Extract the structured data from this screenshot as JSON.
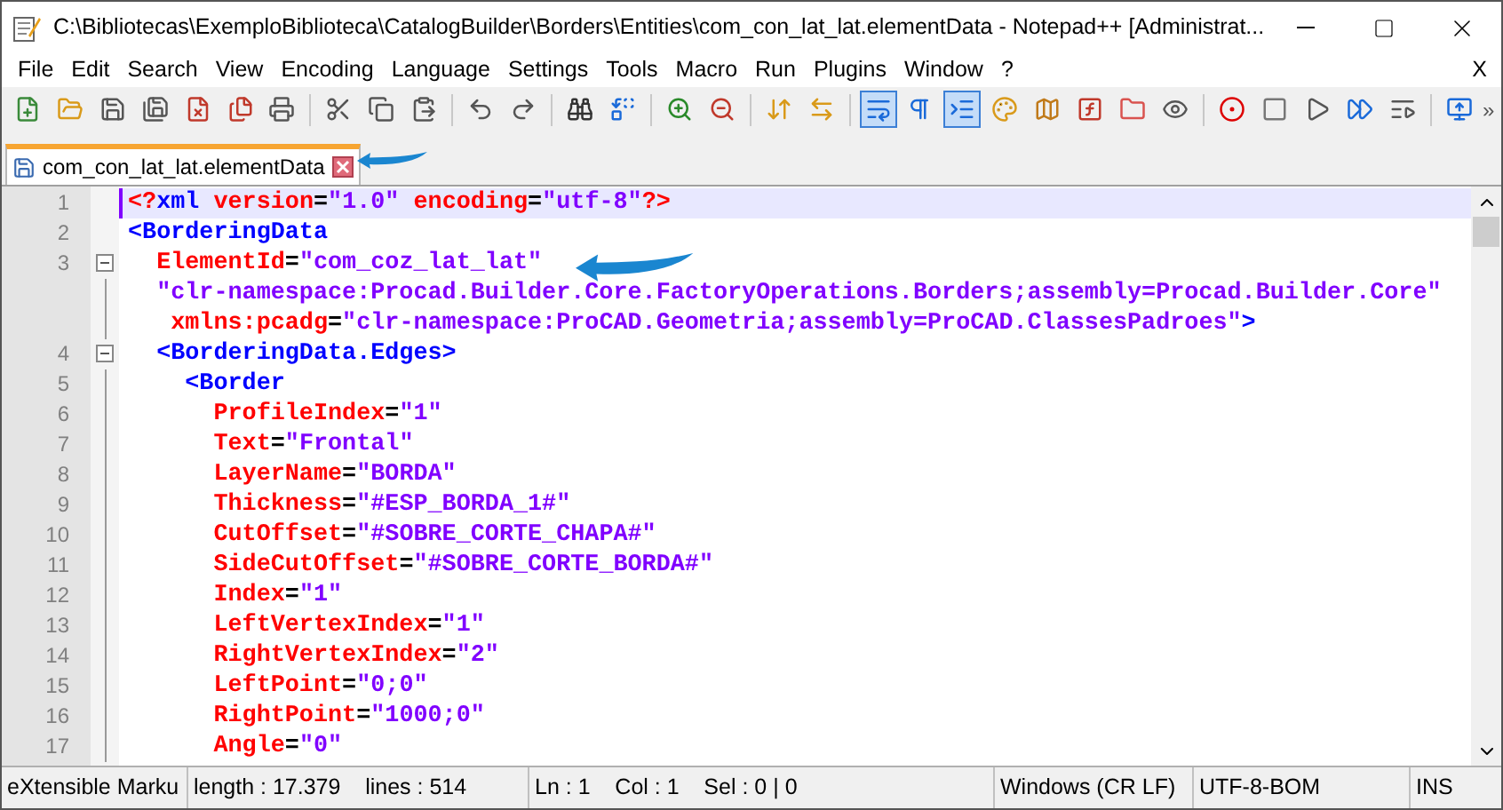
{
  "window": {
    "title": "C:\\Bibliotecas\\ExemploBiblioteca\\CatalogBuilder\\Borders\\Entities\\com_con_lat_lat.elementData - Notepad++ [Administrat..."
  },
  "menu": [
    "File",
    "Edit",
    "Search",
    "View",
    "Encoding",
    "Language",
    "Settings",
    "Tools",
    "Macro",
    "Run",
    "Plugins",
    "Window",
    "?"
  ],
  "menu_close": "X",
  "toolbar": [
    {
      "kind": "new",
      "selected": false
    },
    {
      "kind": "open",
      "selected": false
    },
    {
      "kind": "save",
      "selected": false
    },
    {
      "kind": "save-all",
      "selected": false
    },
    {
      "kind": "close",
      "selected": false
    },
    {
      "kind": "close-all",
      "selected": false
    },
    {
      "kind": "print",
      "selected": false
    },
    {
      "kind": "separator"
    },
    {
      "kind": "cut",
      "selected": false
    },
    {
      "kind": "copy",
      "selected": false
    },
    {
      "kind": "paste",
      "selected": false
    },
    {
      "kind": "separator"
    },
    {
      "kind": "undo",
      "selected": false
    },
    {
      "kind": "redo",
      "selected": false
    },
    {
      "kind": "separator"
    },
    {
      "kind": "find",
      "selected": false
    },
    {
      "kind": "replace",
      "selected": false
    },
    {
      "kind": "separator"
    },
    {
      "kind": "zoom-in",
      "selected": false
    },
    {
      "kind": "zoom-out",
      "selected": false
    },
    {
      "kind": "separator"
    },
    {
      "kind": "sync-vertical",
      "selected": false
    },
    {
      "kind": "sync-horizontal",
      "selected": false
    },
    {
      "kind": "separator"
    },
    {
      "kind": "word-wrap",
      "selected": true
    },
    {
      "kind": "all-chars",
      "selected": false
    },
    {
      "kind": "indent-guide",
      "selected": true
    },
    {
      "kind": "language",
      "selected": false
    },
    {
      "kind": "doc-map",
      "selected": false
    },
    {
      "kind": "function-list",
      "selected": false
    },
    {
      "kind": "folder",
      "selected": false
    },
    {
      "kind": "monitor",
      "selected": false
    },
    {
      "kind": "separator"
    },
    {
      "kind": "record",
      "selected": false
    },
    {
      "kind": "stop",
      "selected": false
    },
    {
      "kind": "play",
      "selected": false
    },
    {
      "kind": "play-multiple",
      "selected": false
    },
    {
      "kind": "save-macro",
      "selected": false
    },
    {
      "kind": "separator"
    },
    {
      "kind": "screen",
      "selected": false
    }
  ],
  "toolbar_overflow": "»",
  "tabs": [
    {
      "label": "com_con_lat_lat.elementData",
      "selected": true
    }
  ],
  "editor": {
    "lines": [
      {
        "number": "1",
        "current": true,
        "rows": [
          {
            "segments": [
              {
                "kind": "pi",
                "text": "<?"
              },
              {
                "kind": "tag",
                "text": "xml "
              },
              {
                "kind": "attr",
                "text": "version"
              },
              {
                "kind": "plain",
                "text": "="
              },
              {
                "kind": "value",
                "text": "\"1.0\" "
              },
              {
                "kind": "attr",
                "text": "encoding"
              },
              {
                "kind": "plain",
                "text": "="
              },
              {
                "kind": "value",
                "text": "\"utf-8\""
              },
              {
                "kind": "pi",
                "text": "?>"
              }
            ]
          }
        ]
      },
      {
        "number": "2",
        "current": false,
        "rows": [
          {
            "segments": [
              {
                "kind": "tag",
                "text": "<BorderingData"
              }
            ]
          }
        ]
      },
      {
        "number": "3",
        "current": false,
        "fold": {
          "expanded": true
        },
        "rows": [
          {
            "segments": [
              {
                "kind": "attr",
                "text": "  ElementId"
              },
              {
                "kind": "plain",
                "text": "="
              },
              {
                "kind": "value",
                "text": "\"com_coz_lat_lat\""
              }
            ]
          },
          {
            "segments": [
              {
                "kind": "value",
                "text": "  \"clr-namespace:Procad.Builder.Core.FactoryOperations.Borders;assembly=Procad.Builder.Core\""
              }
            ]
          },
          {
            "segments": [
              {
                "kind": "attr",
                "text": "   xmlns:pcadg"
              },
              {
                "kind": "plain",
                "text": "="
              },
              {
                "kind": "value",
                "text": "\"clr-namespace:ProCAD.Geometria;assembly=ProCAD.ClassesPadroes\""
              },
              {
                "kind": "tag",
                "text": ">"
              }
            ]
          }
        ]
      },
      {
        "number": "4",
        "current": false,
        "fold": {
          "expanded": true
        },
        "rows": [
          {
            "segments": [
              {
                "kind": "tag",
                "text": "  <BorderingData.Edges>"
              }
            ]
          }
        ]
      },
      {
        "number": "5",
        "current": false,
        "rows": [
          {
            "segments": [
              {
                "kind": "tag",
                "text": "    <Border"
              }
            ]
          }
        ]
      },
      {
        "number": "6",
        "current": false,
        "rows": [
          {
            "segments": [
              {
                "kind": "attr",
                "text": "      ProfileIndex"
              },
              {
                "kind": "plain",
                "text": "="
              },
              {
                "kind": "value",
                "text": "\"1\""
              }
            ]
          }
        ]
      },
      {
        "number": "7",
        "current": false,
        "rows": [
          {
            "segments": [
              {
                "kind": "attr",
                "text": "      Text"
              },
              {
                "kind": "plain",
                "text": "="
              },
              {
                "kind": "value",
                "text": "\"Frontal\""
              }
            ]
          }
        ]
      },
      {
        "number": "8",
        "current": false,
        "rows": [
          {
            "segments": [
              {
                "kind": "attr",
                "text": "      LayerName"
              },
              {
                "kind": "plain",
                "text": "="
              },
              {
                "kind": "value",
                "text": "\"BORDA\""
              }
            ]
          }
        ]
      },
      {
        "number": "9",
        "current": false,
        "rows": [
          {
            "segments": [
              {
                "kind": "attr",
                "text": "      Thickness"
              },
              {
                "kind": "plain",
                "text": "="
              },
              {
                "kind": "value",
                "text": "\"#ESP_BORDA_1#\""
              }
            ]
          }
        ]
      },
      {
        "number": "10",
        "current": false,
        "rows": [
          {
            "segments": [
              {
                "kind": "attr",
                "text": "      CutOffset"
              },
              {
                "kind": "plain",
                "text": "="
              },
              {
                "kind": "value",
                "text": "\"#SOBRE_CORTE_CHAPA#\""
              }
            ]
          }
        ]
      },
      {
        "number": "11",
        "current": false,
        "rows": [
          {
            "segments": [
              {
                "kind": "attr",
                "text": "      SideCutOffset"
              },
              {
                "kind": "plain",
                "text": "="
              },
              {
                "kind": "value",
                "text": "\"#SOBRE_CORTE_BORDA#\""
              }
            ]
          }
        ]
      },
      {
        "number": "12",
        "current": false,
        "rows": [
          {
            "segments": [
              {
                "kind": "attr",
                "text": "      Index"
              },
              {
                "kind": "plain",
                "text": "="
              },
              {
                "kind": "value",
                "text": "\"1\""
              }
            ]
          }
        ]
      },
      {
        "number": "13",
        "current": false,
        "rows": [
          {
            "segments": [
              {
                "kind": "attr",
                "text": "      LeftVertexIndex"
              },
              {
                "kind": "plain",
                "text": "="
              },
              {
                "kind": "value",
                "text": "\"1\""
              }
            ]
          }
        ]
      },
      {
        "number": "14",
        "current": false,
        "rows": [
          {
            "segments": [
              {
                "kind": "attr",
                "text": "      RightVertexIndex"
              },
              {
                "kind": "plain",
                "text": "="
              },
              {
                "kind": "value",
                "text": "\"2\""
              }
            ]
          }
        ]
      },
      {
        "number": "15",
        "current": false,
        "rows": [
          {
            "segments": [
              {
                "kind": "attr",
                "text": "      LeftPoint"
              },
              {
                "kind": "plain",
                "text": "="
              },
              {
                "kind": "value",
                "text": "\"0;0\""
              }
            ]
          }
        ]
      },
      {
        "number": "16",
        "current": false,
        "rows": [
          {
            "segments": [
              {
                "kind": "attr",
                "text": "      RightPoint"
              },
              {
                "kind": "plain",
                "text": "="
              },
              {
                "kind": "value",
                "text": "\"1000;0\""
              }
            ]
          }
        ]
      },
      {
        "number": "17",
        "current": false,
        "rows": [
          {
            "segments": [
              {
                "kind": "attr",
                "text": "      Angle"
              },
              {
                "kind": "plain",
                "text": "="
              },
              {
                "kind": "value",
                "text": "\"0\""
              }
            ]
          }
        ]
      }
    ]
  },
  "status_bar": [
    "eXtensible Marku",
    "length : 17.379    lines : 514",
    "Ln : 1    Col : 1    Sel : 0 | 0",
    "Windows (CR LF)",
    "UTF-8-BOM",
    "INS"
  ]
}
